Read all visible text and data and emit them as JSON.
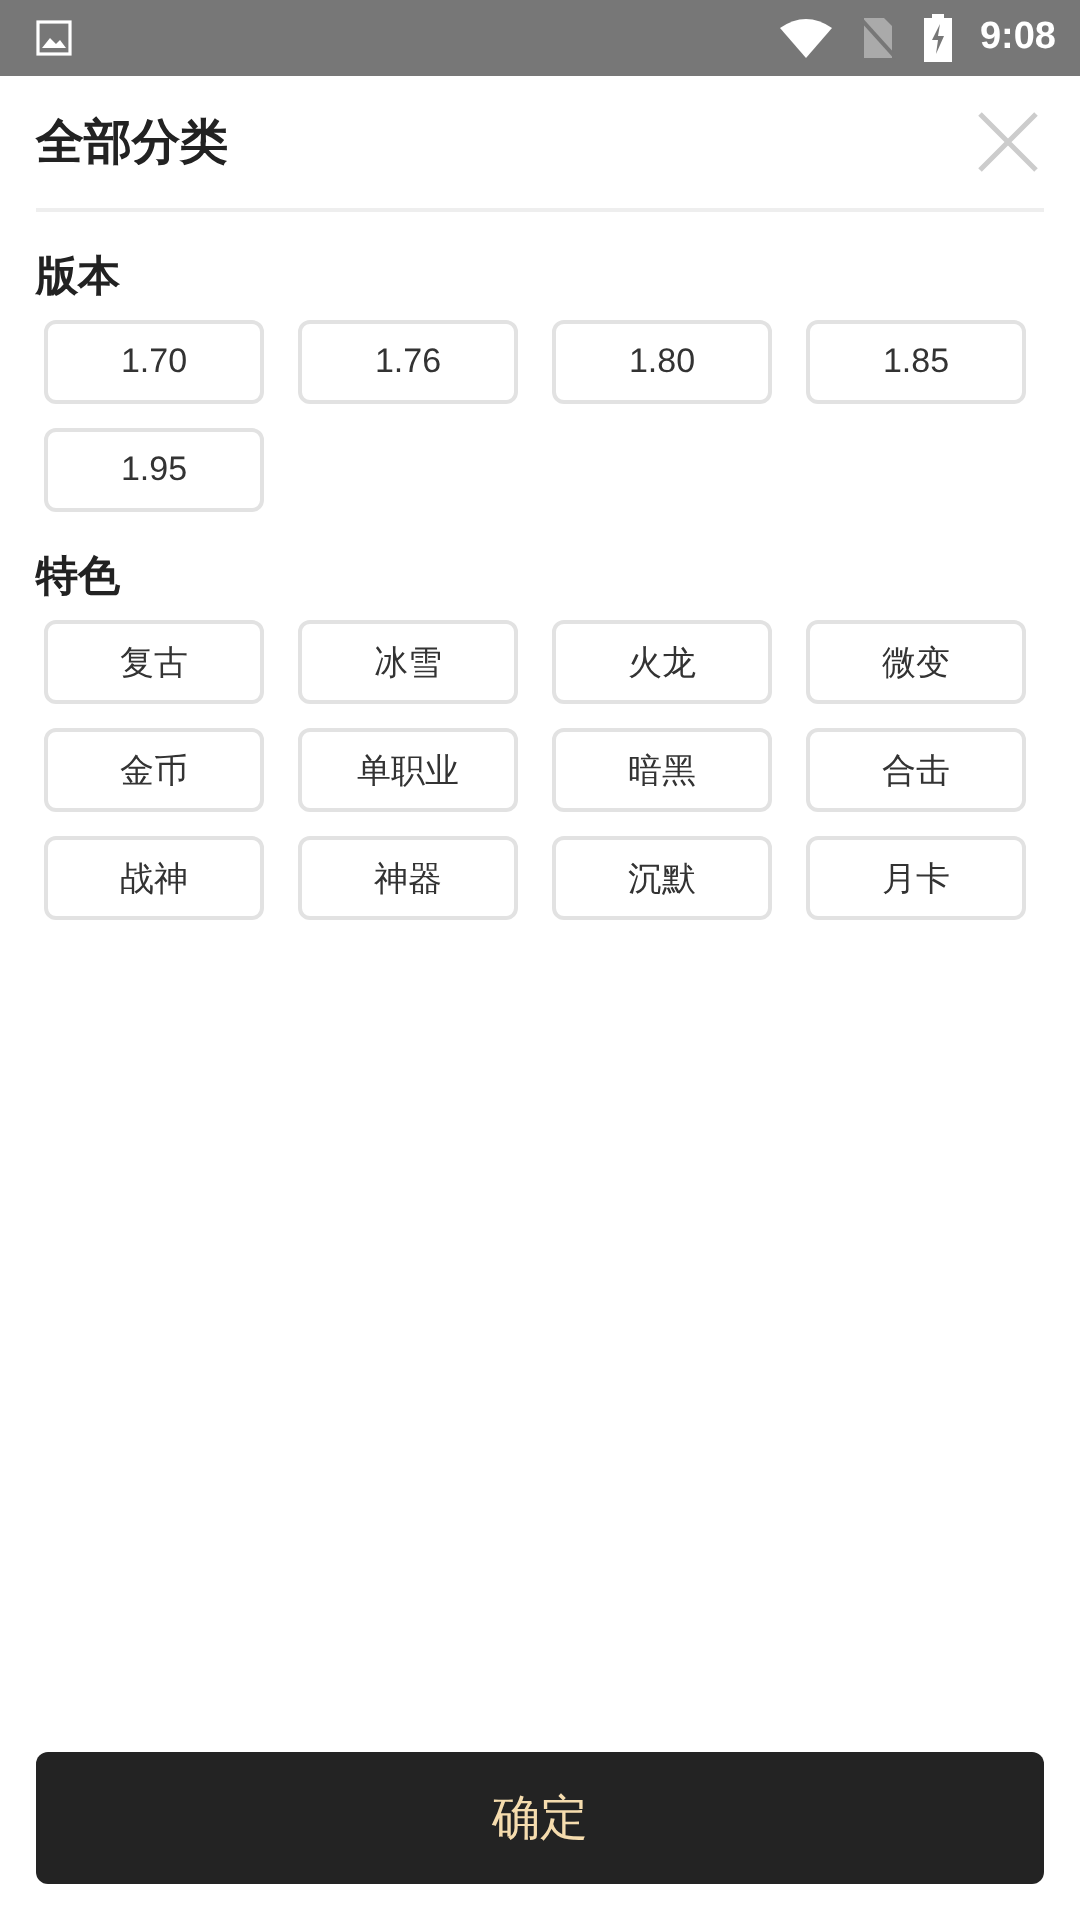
{
  "status_bar": {
    "time": "9:08"
  },
  "header": {
    "title": "全部分类"
  },
  "sections": [
    {
      "title": "版本",
      "options": [
        {
          "label": "1.70",
          "selected": false
        },
        {
          "label": "1.76",
          "selected": false
        },
        {
          "label": "1.80",
          "selected": false
        },
        {
          "label": "1.85",
          "selected": false
        },
        {
          "label": "1.95",
          "selected": false
        }
      ]
    },
    {
      "title": "特色",
      "options": [
        {
          "label": "复古",
          "selected": false
        },
        {
          "label": "冰雪",
          "selected": false
        },
        {
          "label": "火龙",
          "selected": false
        },
        {
          "label": "微变",
          "selected": false
        },
        {
          "label": "金币",
          "selected": false
        },
        {
          "label": "单职业",
          "selected": false
        },
        {
          "label": "暗黑",
          "selected": false
        },
        {
          "label": "合击",
          "selected": false
        },
        {
          "label": "战神",
          "selected": false
        },
        {
          "label": "神器",
          "selected": false
        },
        {
          "label": "沉默",
          "selected": false
        },
        {
          "label": "月卡",
          "selected": false
        }
      ]
    }
  ],
  "confirm_button": "确定"
}
